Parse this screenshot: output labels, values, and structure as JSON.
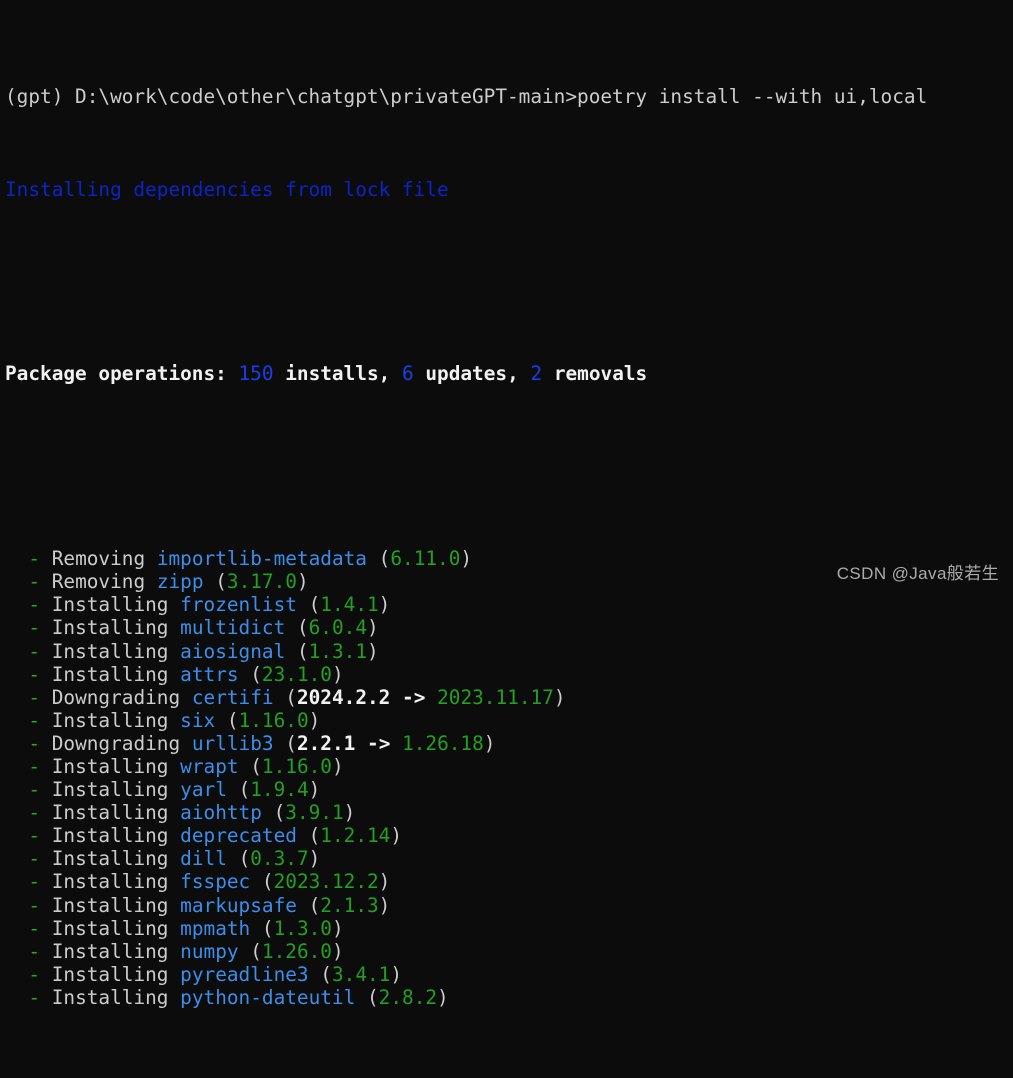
{
  "terminal": {
    "background": "#0c0c0c",
    "foreground": "#cccccc",
    "colors": {
      "dash_green": "#1daf1d",
      "package_blue": "#3b8eea",
      "version_green": "#22a022",
      "info_blue": "#0c24c6",
      "count_blue": "#1540e8",
      "bold_white": "#f2f2f2"
    },
    "prompt": {
      "env": "(gpt)",
      "cwd": "D:\\work\\code\\other\\chatgpt\\privateGPT-main",
      "symbol": ">",
      "command": "poetry install --with ui,local",
      "full_line": "(gpt) D:\\work\\code\\other\\chatgpt\\privateGPT-main>poetry install --with ui,local"
    },
    "status_line": "Installing dependencies from lock file",
    "summary": {
      "label": "Package operations:",
      "installs_count": "150",
      "installs_word": "installs,",
      "updates_count": "6",
      "updates_word": "updates,",
      "removals_count": "2",
      "removals_word": "removals"
    },
    "operations": [
      {
        "action": "Removing",
        "package": "importlib-metadata",
        "version": "6.11.0"
      },
      {
        "action": "Removing",
        "package": "zipp",
        "version": "3.17.0"
      },
      {
        "action": "Installing",
        "package": "frozenlist",
        "version": "1.4.1"
      },
      {
        "action": "Installing",
        "package": "multidict",
        "version": "6.0.4"
      },
      {
        "action": "Installing",
        "package": "aiosignal",
        "version": "1.3.1"
      },
      {
        "action": "Installing",
        "package": "attrs",
        "version": "23.1.0"
      },
      {
        "action": "Downgrading",
        "package": "certifi",
        "from_version": "2024.2.2",
        "arrow": "->",
        "version": "2023.11.17"
      },
      {
        "action": "Installing",
        "package": "six",
        "version": "1.16.0"
      },
      {
        "action": "Downgrading",
        "package": "urllib3",
        "from_version": "2.2.1",
        "arrow": "->",
        "version": "1.26.18"
      },
      {
        "action": "Installing",
        "package": "wrapt",
        "version": "1.16.0"
      },
      {
        "action": "Installing",
        "package": "yarl",
        "version": "1.9.4"
      },
      {
        "action": "Installing",
        "package": "aiohttp",
        "version": "3.9.1"
      },
      {
        "action": "Installing",
        "package": "deprecated",
        "version": "1.2.14"
      },
      {
        "action": "Installing",
        "package": "dill",
        "version": "0.3.7"
      },
      {
        "action": "Installing",
        "package": "fsspec",
        "version": "2023.12.2"
      },
      {
        "action": "Installing",
        "package": "markupsafe",
        "version": "2.1.3"
      },
      {
        "action": "Installing",
        "package": "mpmath",
        "version": "1.3.0"
      },
      {
        "action": "Installing",
        "package": "numpy",
        "version": "1.26.0"
      },
      {
        "action": "Installing",
        "package": "pyreadline3",
        "version": "3.4.1"
      },
      {
        "action": "Installing",
        "package": "python-dateutil",
        "version": "2.8.2"
      }
    ],
    "bullet": "-",
    "indent": "  ",
    "watermark": "CSDN @Java般若生"
  }
}
